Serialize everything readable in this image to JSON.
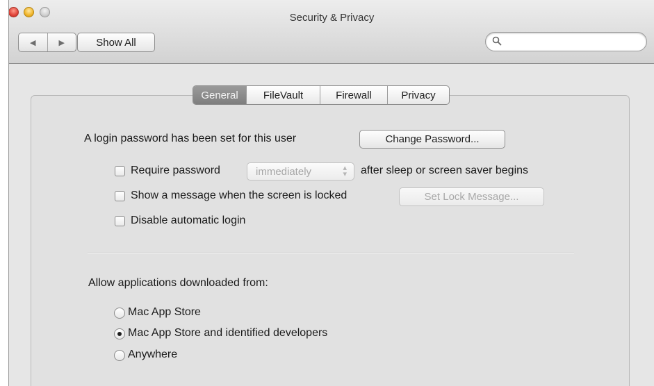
{
  "window": {
    "title": "Security & Privacy"
  },
  "toolbar": {
    "back_icon": "◀",
    "forward_icon": "▶",
    "show_all_label": "Show All",
    "search_placeholder": ""
  },
  "tabs": [
    {
      "label": "General",
      "active": true
    },
    {
      "label": "FileVault",
      "active": false
    },
    {
      "label": "Firewall",
      "active": false
    },
    {
      "label": "Privacy",
      "active": false
    }
  ],
  "general": {
    "login_password_text": "A login password has been set for this user",
    "change_password_label": "Change Password...",
    "require_password": {
      "label": "Require password",
      "checked": false,
      "popup_value": "immediately",
      "suffix": "after sleep or screen saver begins"
    },
    "show_message": {
      "label": "Show a message when the screen is locked",
      "checked": false,
      "button_label": "Set Lock Message..."
    },
    "disable_auto_login": {
      "label": "Disable automatic login",
      "checked": false
    },
    "allow_apps_label": "Allow applications downloaded from:",
    "download_options": [
      {
        "label": "Mac App Store",
        "selected": false
      },
      {
        "label": "Mac App Store and identified developers",
        "selected": true
      },
      {
        "label": "Anywhere",
        "selected": false
      }
    ]
  }
}
